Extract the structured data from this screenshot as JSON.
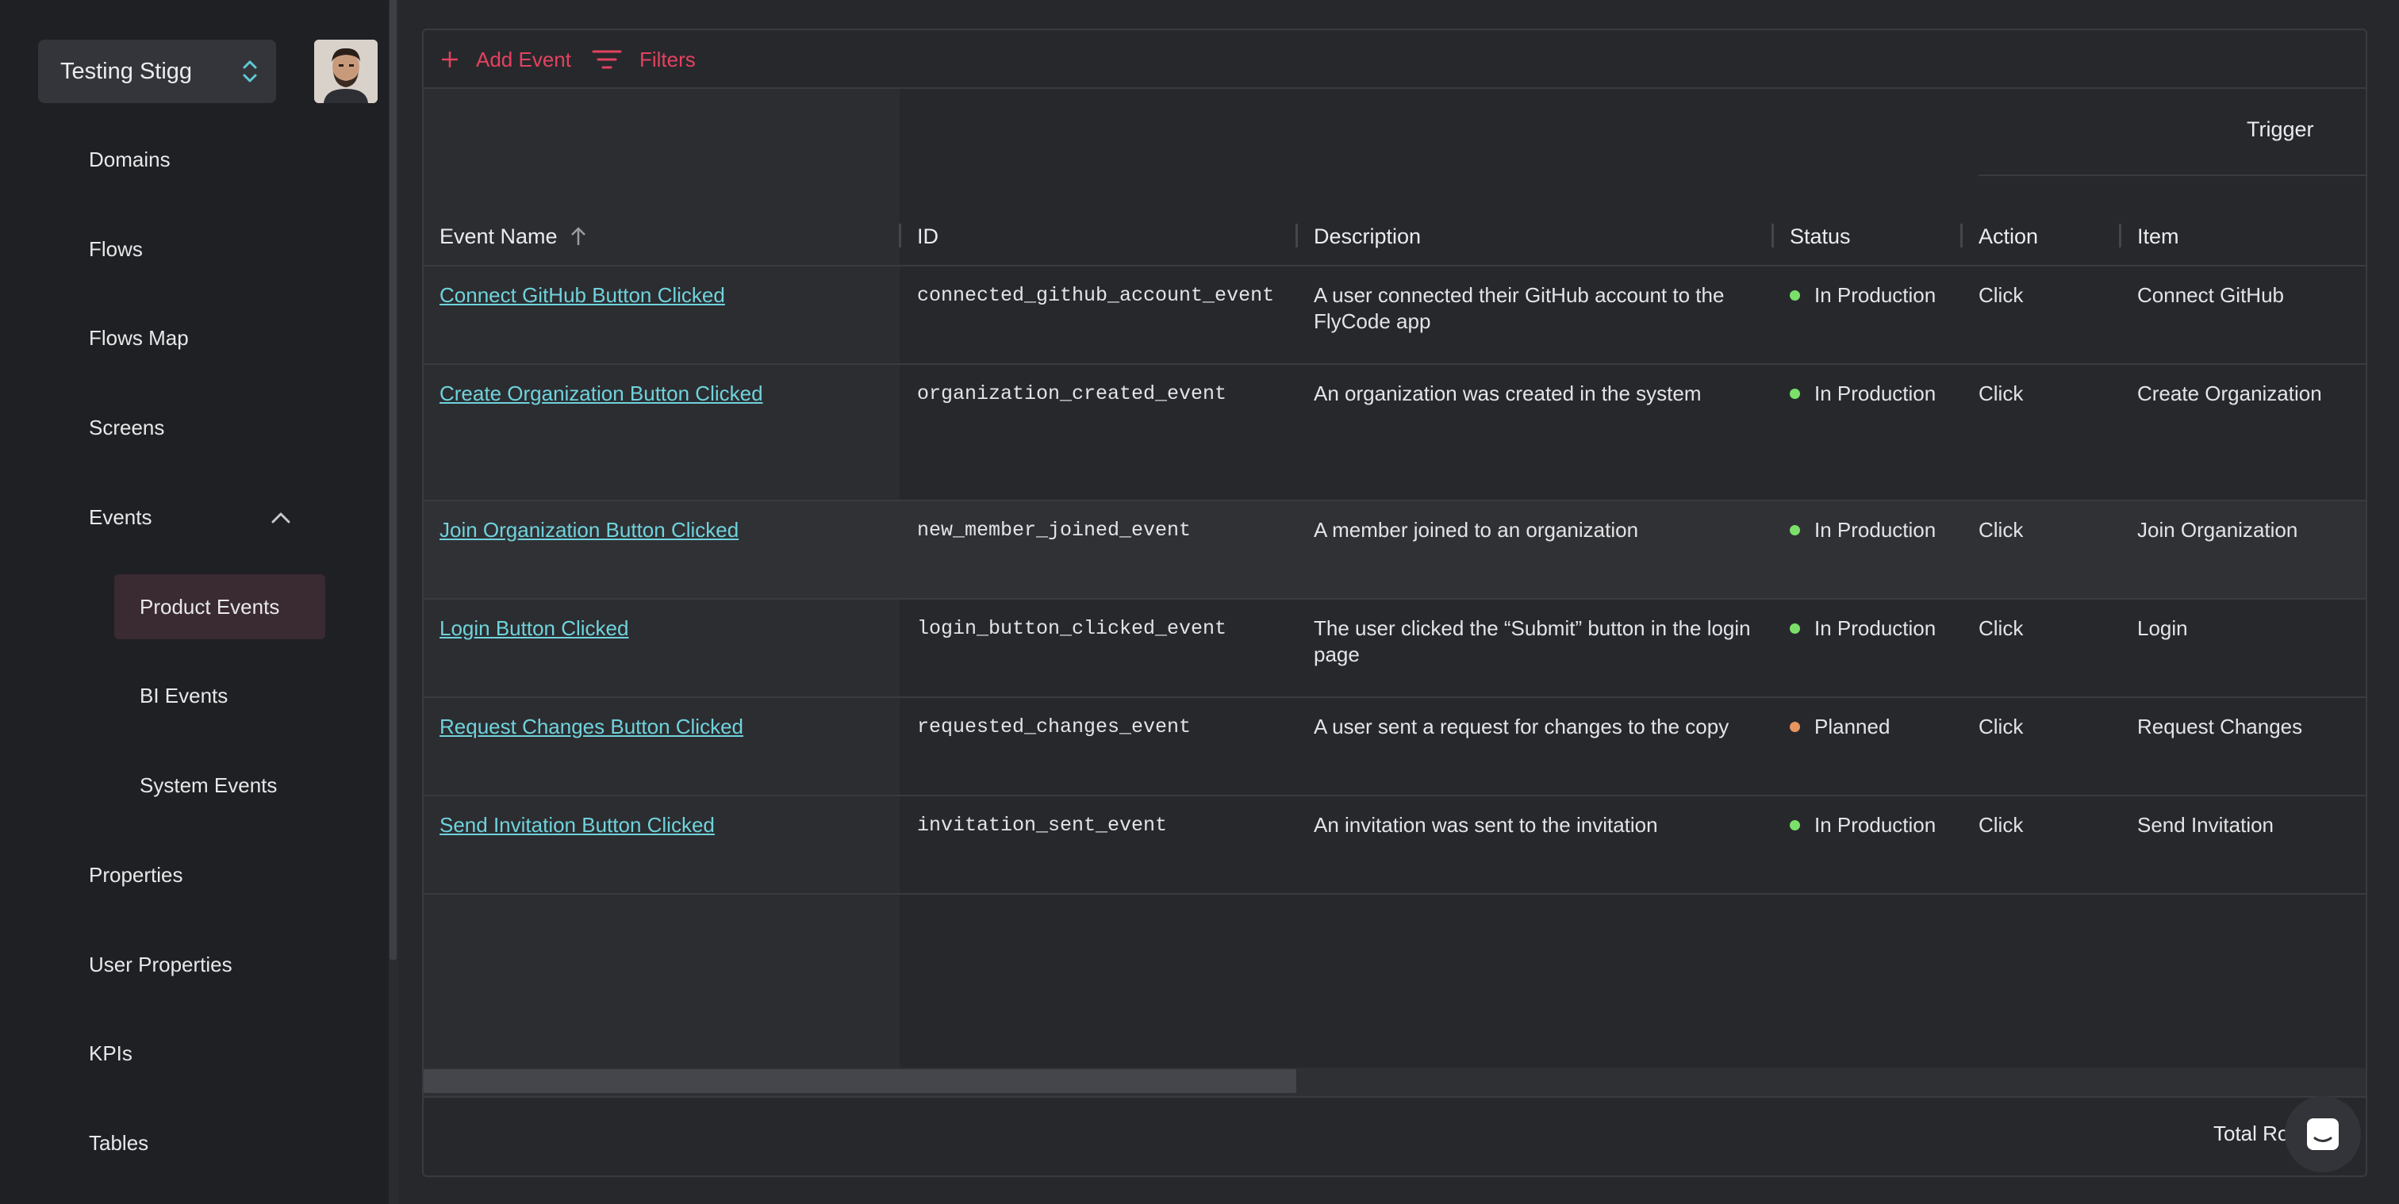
{
  "workspace": {
    "name": "Testing Stigg"
  },
  "sidebar": {
    "items": [
      {
        "label": "Domains"
      },
      {
        "label": "Flows"
      },
      {
        "label": "Flows Map"
      },
      {
        "label": "Screens"
      },
      {
        "label": "Events"
      },
      {
        "label": "Properties"
      },
      {
        "label": "User Properties"
      },
      {
        "label": "KPIs"
      },
      {
        "label": "Tables"
      }
    ],
    "events_children": [
      {
        "label": "Product Events",
        "active": true
      },
      {
        "label": "BI Events"
      },
      {
        "label": "System Events"
      }
    ]
  },
  "toolbar": {
    "add_event_label": "Add Event",
    "filters_label": "Filters"
  },
  "table": {
    "group_header": "Trigger",
    "columns": {
      "event_name": "Event Name",
      "id": "ID",
      "description": "Description",
      "status": "Status",
      "action": "Action",
      "item": "Item"
    },
    "rows": [
      {
        "name": "Connect GitHub Button Clicked",
        "id": "connected_github_account_event",
        "description": "A user connected their GitHub account to the FlyCode app",
        "status": "In Production",
        "action": "Click",
        "item": "Connect GitHub"
      },
      {
        "name": "Create Organization Button Clicked",
        "id": "organization_created_event",
        "description": "An organization was created in the system",
        "status": "In Production",
        "action": "Click",
        "item": "Create Organization"
      },
      {
        "name": "Join Organization Button Clicked",
        "id": "new_member_joined_event",
        "description": "A member joined to an organization",
        "status": "In Production",
        "action": "Click",
        "item": "Join Organization"
      },
      {
        "name": "Login Button Clicked",
        "id": "login_button_clicked_event",
        "description": "The user clicked the “Submit” button in the login page",
        "status": "In Production",
        "action": "Click",
        "item": "Login"
      },
      {
        "name": "Request Changes Button Clicked",
        "id": "requested_changes_event",
        "description": "A user sent a request for changes to the copy",
        "status": "Planned",
        "action": "Click",
        "item": "Request Changes"
      },
      {
        "name": "Send Invitation Button Clicked",
        "id": "invitation_sent_event",
        "description": "An invitation was sent to the invitation",
        "status": "In Production",
        "action": "Click",
        "item": "Send Invitation"
      }
    ],
    "footer": {
      "total_rows_label": "Total Ro"
    }
  },
  "colors": {
    "accent": "#e3425f",
    "link": "#6fd3dc",
    "status_in_production": "#7be06a",
    "status_planned": "#e8955f"
  }
}
